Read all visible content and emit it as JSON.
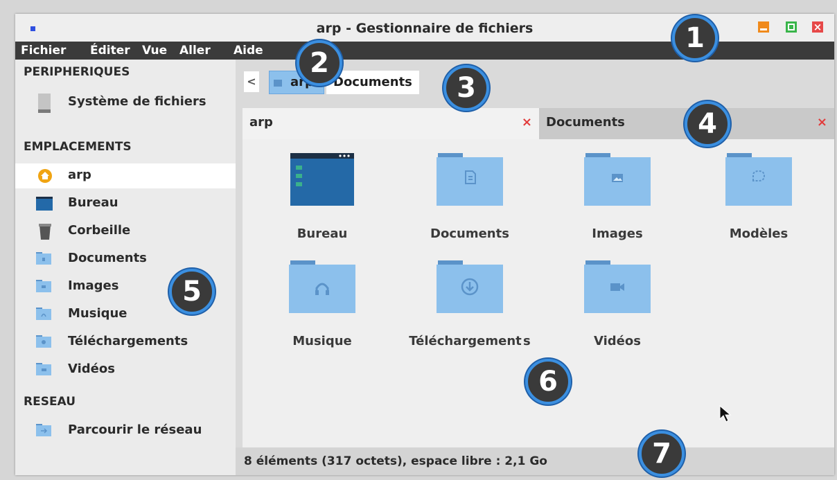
{
  "window": {
    "title": "arp - Gestionnaire de fichiers"
  },
  "menu": [
    "Fichier",
    "Éditer",
    "Vue",
    "Aller",
    "Aide"
  ],
  "sidebar": {
    "sections": {
      "devices": "PERIPHERIQUES",
      "places": "EMPLACEMENTS",
      "network": "RESEAU"
    },
    "devices": [
      {
        "label": "Système de fichiers",
        "icon": "drive-icon"
      }
    ],
    "places": [
      {
        "label": "arp",
        "icon": "home-icon",
        "active": true
      },
      {
        "label": "Bureau",
        "icon": "desktop-icon"
      },
      {
        "label": "Corbeille",
        "icon": "trash-icon"
      },
      {
        "label": "Documents",
        "icon": "folder-documents-icon"
      },
      {
        "label": "Images",
        "icon": "folder-images-icon"
      },
      {
        "label": "Musique",
        "icon": "folder-music-icon"
      },
      {
        "label": "Téléchargements",
        "icon": "folder-downloads-icon"
      },
      {
        "label": "Vidéos",
        "icon": "folder-videos-icon"
      }
    ],
    "network": [
      {
        "label": "Parcourir le réseau",
        "icon": "network-folder-icon"
      }
    ]
  },
  "pathbar": {
    "back": "<",
    "crumbs": [
      "arp",
      "Documents"
    ]
  },
  "tabs": [
    {
      "label": "arp",
      "close": "×",
      "active": true
    },
    {
      "label": "Documents",
      "close": "×",
      "active": false
    }
  ],
  "files": [
    {
      "label": "Bureau",
      "icon": "desktop-icon"
    },
    {
      "label": "Documents",
      "icon": "folder-documents-icon"
    },
    {
      "label": "Images",
      "icon": "folder-images-icon"
    },
    {
      "label": "Modèles",
      "icon": "folder-templates-icon"
    },
    {
      "label": "Musique",
      "icon": "folder-music-icon"
    },
    {
      "label": "Téléchargement s",
      "icon": "folder-downloads-icon"
    },
    {
      "label": "Vidéos",
      "icon": "folder-videos-icon"
    }
  ],
  "status": "8 éléments (317 octets), espace libre : 2,1 Go",
  "callouts": [
    "1",
    "2",
    "3",
    "4",
    "5",
    "6",
    "7"
  ],
  "colors": {
    "menubar": "#3b3b3b",
    "folder": "#8cc0ec",
    "selection": "#8cc0ec",
    "callout_ring": "#3b8fe0",
    "close_red": "#e23b3b"
  }
}
